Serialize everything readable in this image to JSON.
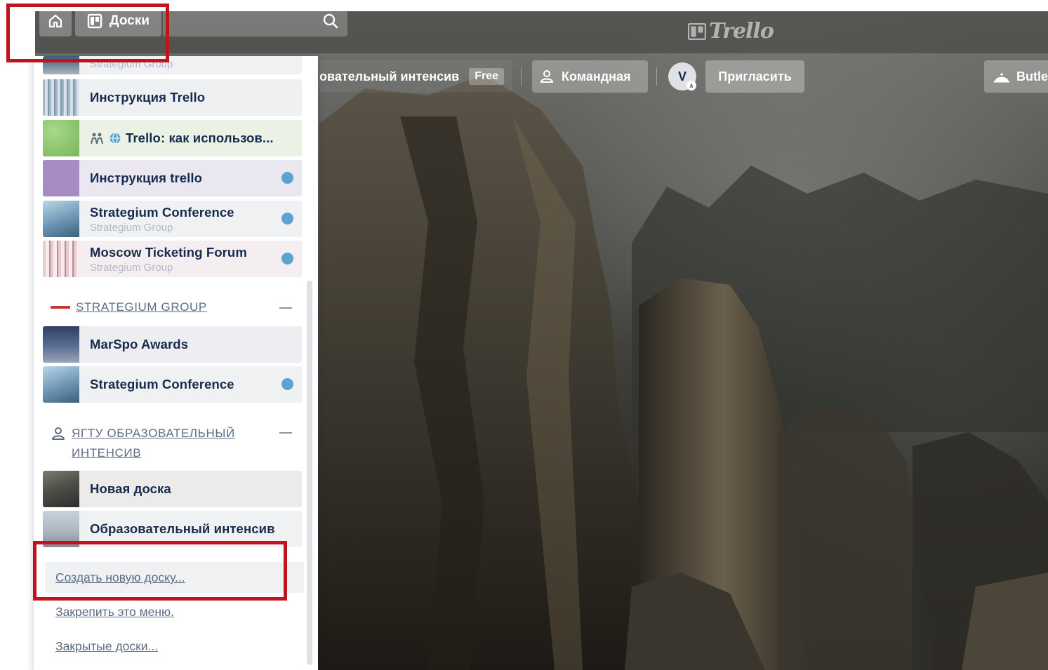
{
  "header": {
    "boards_label": "Доски",
    "logo_text": "Trello"
  },
  "board_header": {
    "title_partial": "овательный интенсив",
    "plan_badge": "Free",
    "team_label": "Командная",
    "avatar_initial": "V",
    "invite_label": "Пригласить",
    "butler_label": "Butle"
  },
  "boards_menu": {
    "partial_item_sub": "Strategium Group",
    "recent": [
      {
        "name": "Инструкция Trello",
        "sub": "",
        "starred": false
      },
      {
        "name": "Trello: как использов...",
        "sub": "",
        "starred": false
      },
      {
        "name": "Инструкция trello",
        "sub": "",
        "starred": true
      },
      {
        "name": "Strategium Conference",
        "sub": "Strategium Group",
        "starred": true
      },
      {
        "name": "Moscow Ticketing Forum",
        "sub": "Strategium Group",
        "starred": true
      }
    ],
    "teams": [
      {
        "name": "STRATEGIUM GROUP",
        "boards": [
          {
            "name": "MarSpo Awards",
            "starred": false
          },
          {
            "name": "Strategium Conference",
            "starred": true
          }
        ]
      },
      {
        "name": "ЯГТУ ОБРАЗОВАТЕЛЬНЫЙ ИНТЕНСИВ",
        "boards": [
          {
            "name": "Новая доска",
            "starred": false
          },
          {
            "name": "Образовательный интенсив",
            "starred": false
          }
        ]
      }
    ],
    "create_board": "Создать новую доску...",
    "pin_menu": "Закрепить это меню.",
    "closed_boards": "Закрытые доски..."
  },
  "colors": {
    "highlight": "#c0141c",
    "star_dot": "#5ba4cf",
    "text_dark": "#172b4d",
    "text_muted": "#5e6c84"
  }
}
